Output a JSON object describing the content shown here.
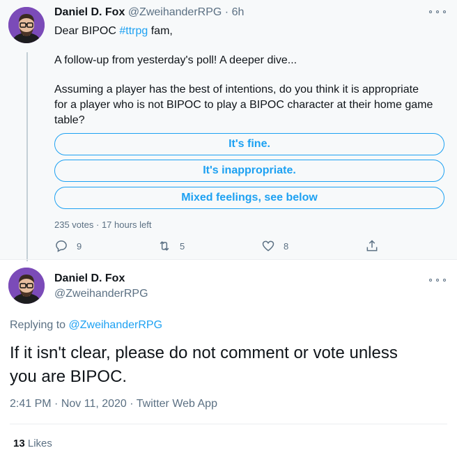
{
  "tweet": {
    "author_name": "Daniel D. Fox",
    "author_handle": "@ZweihanderRPG",
    "time_ago": "6h",
    "greeting_prefix": "Dear BIPOC ",
    "hashtag": "#ttrpg",
    "greeting_suffix": " fam,",
    "paragraph1": "A follow-up from yesterday's poll! A deeper dive...",
    "paragraph2_line1": "Assuming a player has the best of intentions, do you think it is appropriate",
    "paragraph2_line2": "for a player who is not BIPOC to play a BIPOC character at their home game",
    "paragraph2_line3": "table?",
    "poll": {
      "options": [
        "It's fine.",
        "It's inappropriate.",
        "Mixed feelings, see below"
      ],
      "votes": "235 votes",
      "time_left": "17 hours left"
    },
    "actions": {
      "replies": "9",
      "retweets": "5",
      "likes": "8"
    }
  },
  "reply": {
    "author_name": "Daniel D. Fox",
    "author_handle": "@ZweihanderRPG",
    "replying_label": "Replying to ",
    "replying_handle": "@ZweihanderRPG",
    "text_line1": "If it isn't clear, please do not comment or vote unless",
    "text_line2": "you are BIPOC.",
    "time": "2:41 PM",
    "date": "Nov 11, 2020",
    "source": "Twitter Web App",
    "likes_count": "13",
    "likes_label": "Likes"
  },
  "colors": {
    "accent": "#1da1f2",
    "muted": "#5b7083",
    "avatar_bg": "#7b4bb8"
  },
  "icons": [
    "more-icon",
    "reply-icon",
    "retweet-icon",
    "like-icon",
    "share-icon"
  ]
}
